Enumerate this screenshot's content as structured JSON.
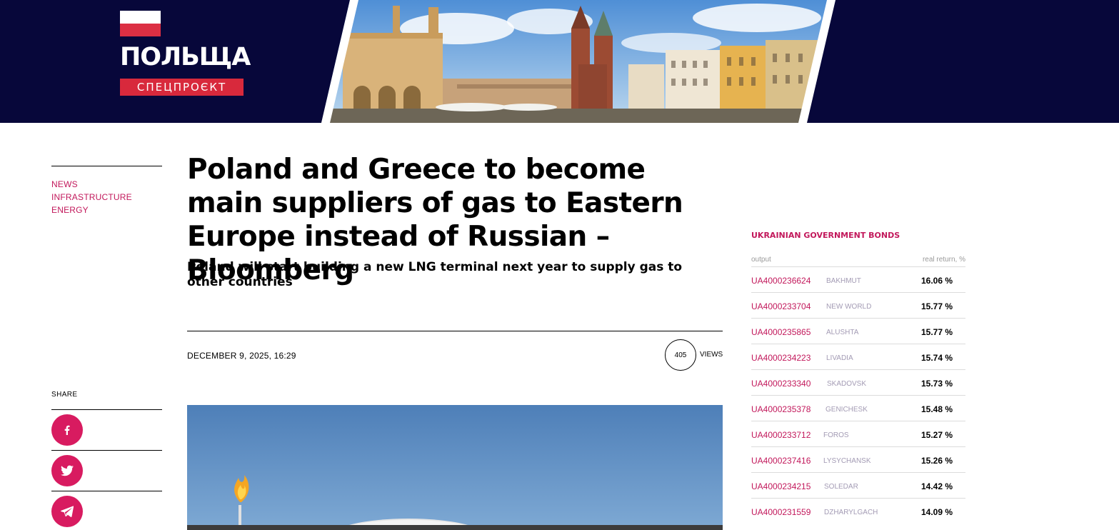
{
  "banner": {
    "title": "ПОЛЬЩА",
    "tag": "СПЕЦПРОЄКТ",
    "colors": {
      "background": "#07073a",
      "accent": "#d8293c"
    }
  },
  "tags": [
    "NEWS",
    "INFRASTRUCTURE",
    "ENERGY"
  ],
  "article": {
    "title": "Poland and Greece to become main suppliers of gas to Eastern Europe instead of Russian – Bloomberg",
    "subtitle": "Poland will start building a new LNG terminal next year to supply gas to other countries",
    "date": "DECEMBER 9, 2025, 16:29",
    "views_count": "405",
    "views_label": "VIEWS"
  },
  "share": {
    "label": "SHARE",
    "buttons": [
      {
        "name": "facebook",
        "icon": "facebook-icon"
      },
      {
        "name": "twitter",
        "icon": "twitter-icon"
      },
      {
        "name": "telegram",
        "icon": "telegram-icon"
      }
    ]
  },
  "bonds": {
    "title": "UKRAINIAN GOVERNMENT BONDS",
    "col_left": "output",
    "col_right": "real return, %",
    "rows": [
      {
        "code": "UA4000236624",
        "city": "BAKHMUT",
        "ret": "16.06 %"
      },
      {
        "code": "UA4000233704",
        "city": "NEW WORLD",
        "ret": "15.77 %"
      },
      {
        "code": "UA4000235865",
        "city": "ALUSHTA",
        "ret": "15.77 %"
      },
      {
        "code": "UA4000234223",
        "city": "LIVADIA",
        "ret": "15.74 %"
      },
      {
        "code": "UA4000233340",
        "city": "SKADOVSK",
        "ret": "15.73 %"
      },
      {
        "code": "UA4000235378",
        "city": "GENICHESK",
        "ret": "15.48 %"
      },
      {
        "code": "UA4000233712",
        "city": "FOROS",
        "ret": "15.27 %"
      },
      {
        "code": "UA4000237416",
        "city": "LYSYCHANSK",
        "ret": "15.26 %"
      },
      {
        "code": "UA4000234215",
        "city": "SOLEDAR",
        "ret": "14.42 %"
      },
      {
        "code": "UA4000231559",
        "city": "DZHARYLGACH",
        "ret": "14.09 %"
      }
    ],
    "colors": {
      "accent": "#c2185b",
      "muted": "#a39bb4"
    }
  }
}
